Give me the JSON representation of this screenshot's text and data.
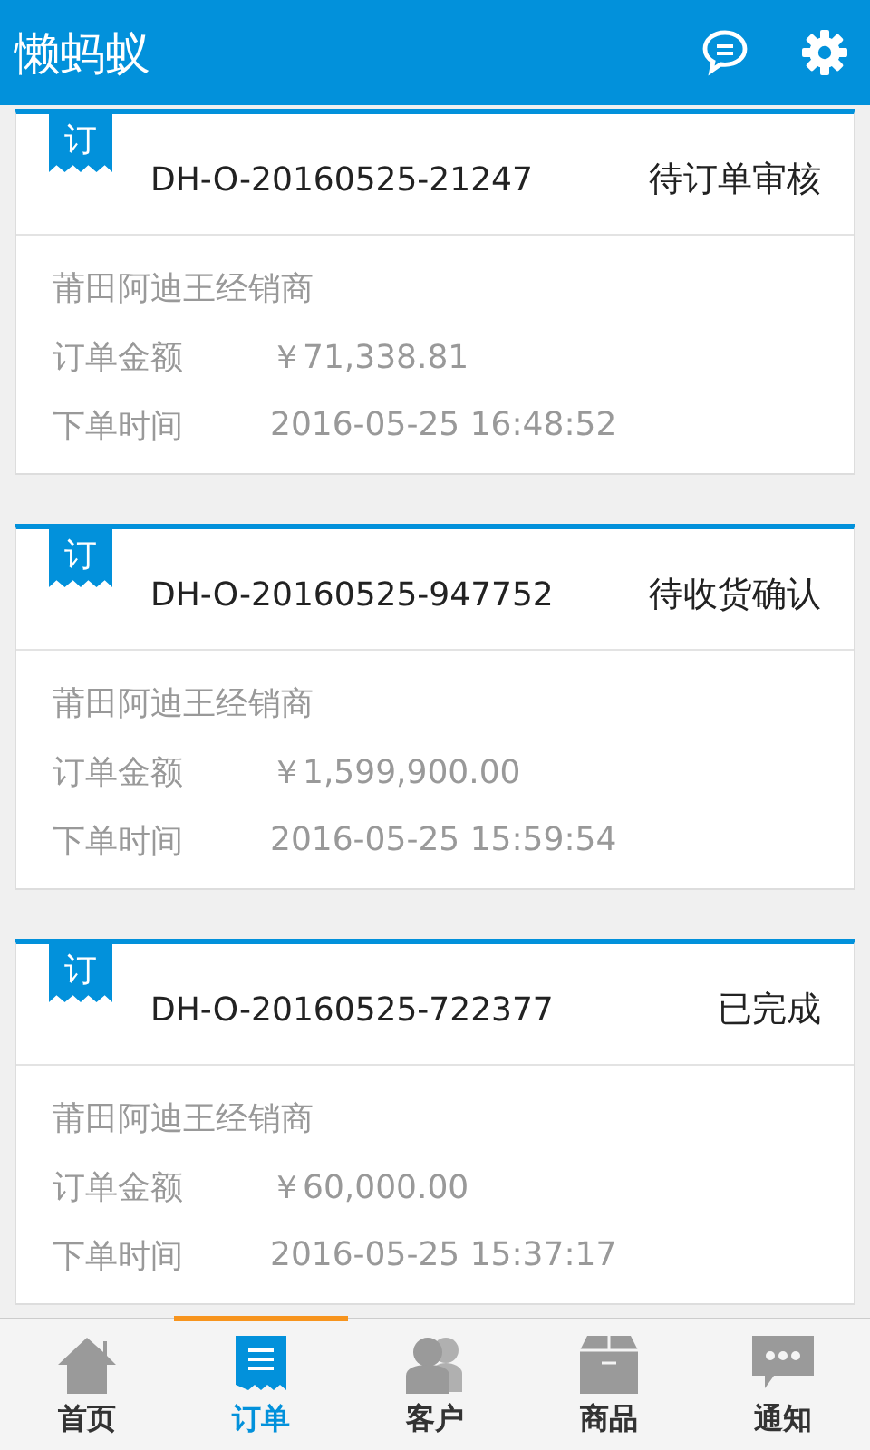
{
  "app_bar": {
    "title": "懒蚂蚁"
  },
  "orders": [
    {
      "badge": "订",
      "number": "DH-O-20160525-21247",
      "status": "待订单审核",
      "dealer": "莆田阿迪王经销商",
      "amount_label": "订单金额",
      "amount": "￥71,338.81",
      "time_label": "下单时间",
      "time": "2016-05-25 16:48:52"
    },
    {
      "badge": "订",
      "number": "DH-O-20160525-947752",
      "status": "待收货确认",
      "dealer": "莆田阿迪王经销商",
      "amount_label": "订单金额",
      "amount": "￥1,599,900.00",
      "time_label": "下单时间",
      "time": "2016-05-25 15:59:54"
    },
    {
      "badge": "订",
      "number": "DH-O-20160525-722377",
      "status": "已完成",
      "dealer": "莆田阿迪王经销商",
      "amount_label": "订单金额",
      "amount": "￥60,000.00",
      "time_label": "下单时间",
      "time": "2016-05-25 15:37:17"
    }
  ],
  "tabs": [
    {
      "label": "首页",
      "kind": "home",
      "selected": false
    },
    {
      "label": "订单",
      "kind": "orders",
      "selected": true
    },
    {
      "label": "客户",
      "kind": "customers",
      "selected": false
    },
    {
      "label": "商品",
      "kind": "goods",
      "selected": false
    },
    {
      "label": "通知",
      "kind": "notices",
      "selected": false
    }
  ]
}
